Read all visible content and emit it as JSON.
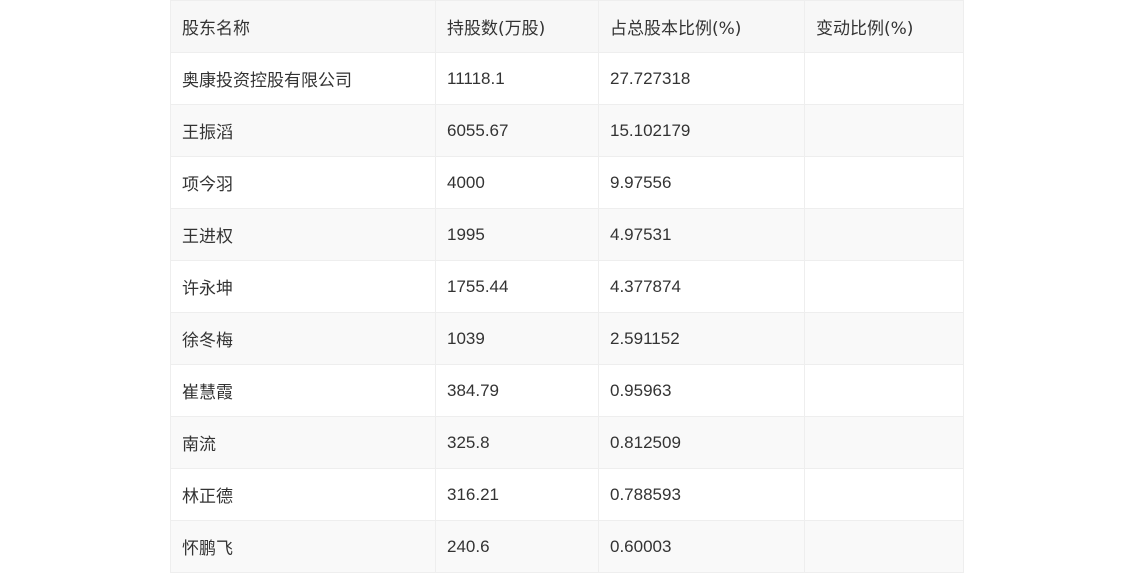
{
  "table": {
    "headers": [
      "股东名称",
      "持股数(万股)",
      "占总股本比例(%)",
      "变动比例(%)"
    ],
    "rows": [
      [
        "奥康投资控股有限公司",
        "11118.1",
        "27.727318",
        ""
      ],
      [
        "王振滔",
        "6055.67",
        "15.102179",
        ""
      ],
      [
        "项今羽",
        "4000",
        "9.97556",
        ""
      ],
      [
        "王进权",
        "1995",
        "4.97531",
        ""
      ],
      [
        "许永坤",
        "1755.44",
        "4.377874",
        ""
      ],
      [
        "徐冬梅",
        "1039",
        "2.591152",
        ""
      ],
      [
        "崔慧霞",
        "384.79",
        "0.95963",
        ""
      ],
      [
        "南流",
        "325.8",
        "0.812509",
        ""
      ],
      [
        "林正德",
        "316.21",
        "0.788593",
        ""
      ],
      [
        "怀鹏飞",
        "240.6",
        "0.60003",
        ""
      ]
    ]
  }
}
